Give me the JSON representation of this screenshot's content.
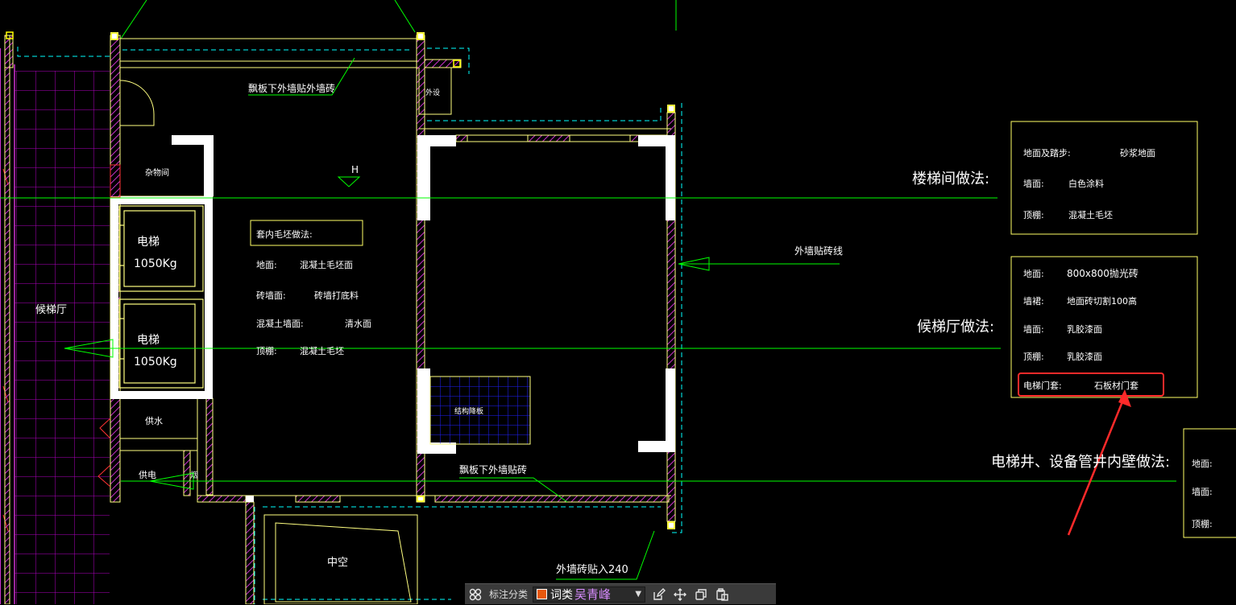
{
  "drawing": {
    "colors": {
      "wall": "#ffff80",
      "hatch": "#cc33cc",
      "grid": "#b000c0",
      "leader": "#00ff00",
      "dash": "#00ffff",
      "annotation_box": "#ffff66",
      "highlight": "#ff2a2a",
      "board": "#1010ff"
    },
    "labels": {
      "canopy_top": "飘板下外墙贴外墙砖",
      "equipment": "外设",
      "elevator_marker": "H",
      "storage": "杂物间",
      "elevator1_name": "电梯",
      "elevator1_cap": "1050Kg",
      "elevator2_name": "电梯",
      "elevator2_cap": "1050Kg",
      "lobby": "候梯厅",
      "water": "供水",
      "power": "供电",
      "shaft": "烟",
      "board": "结构降板",
      "canopy_bottom": "飘板下外墙贴砖",
      "void": "中空",
      "exterior_tile_line": "外墙贴砖线",
      "exterior_tile_in": "外墙砖贴入240"
    },
    "room_notes": {
      "title": "套内毛坯做法:",
      "rows": [
        {
          "k": "地面:",
          "v": "混凝土毛坯面"
        },
        {
          "k": "砖墙面:",
          "v": "砖墙打底料"
        },
        {
          "k": "混凝土墙面:",
          "v": "清水面"
        },
        {
          "k": "顶棚:",
          "v": "混凝土毛坯"
        }
      ]
    },
    "stair_notes": {
      "title": "楼梯间做法:",
      "rows": [
        {
          "k": "地面及踏步:",
          "v": "砂浆地面"
        },
        {
          "k": "墙面:",
          "v": "白色涂料"
        },
        {
          "k": "顶棚:",
          "v": "混凝土毛坯"
        }
      ]
    },
    "lobby_notes": {
      "title": "候梯厅做法:",
      "rows": [
        {
          "k": "地面:",
          "v": "800x800抛光砖"
        },
        {
          "k": "墙裙:",
          "v": "地面砖切割100高"
        },
        {
          "k": "墙面:",
          "v": "乳胶漆面"
        },
        {
          "k": "顶棚:",
          "v": "乳胶漆面"
        },
        {
          "k": "电梯门套:",
          "v": "石板材门套"
        }
      ]
    },
    "shaft_notes": {
      "title": "电梯井、设备管井内壁做法:",
      "rows": [
        {
          "k": "地面:"
        },
        {
          "k": "墙面:"
        },
        {
          "k": "顶棚:"
        }
      ]
    }
  },
  "toolbar": {
    "annotation_category_label": "标注分类",
    "selected_category": "词类",
    "selected_user": "吴青峰",
    "selected_color": "#e8580c"
  }
}
